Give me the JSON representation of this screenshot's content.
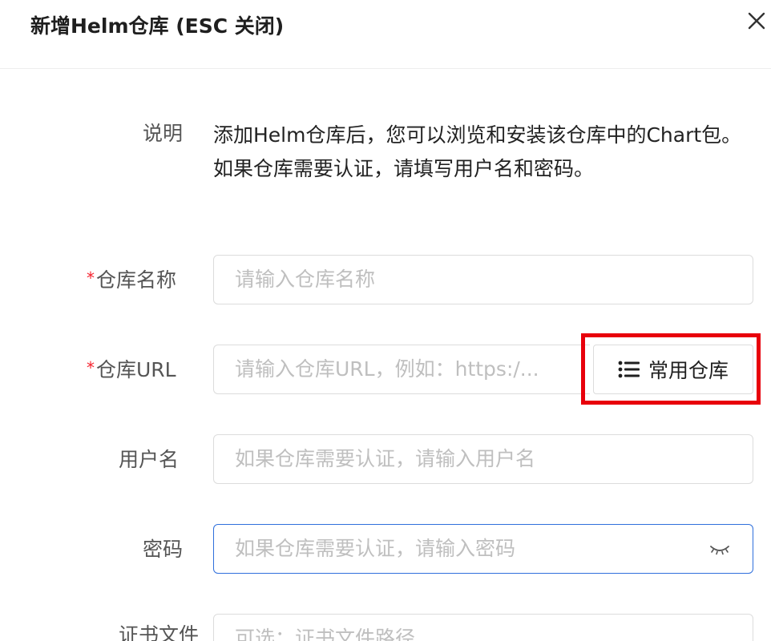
{
  "dialog": {
    "title": "新增Helm仓库 (ESC 关闭)",
    "close_icon": "close-icon"
  },
  "form": {
    "description": {
      "label": "说明",
      "text": "添加Helm仓库后，您可以浏览和安装该仓库中的Chart包。如果仓库需要认证，请填写用户名和密码。"
    },
    "repo_name": {
      "required_mark": "*",
      "label": "仓库名称",
      "placeholder": "请输入仓库名称",
      "value": ""
    },
    "repo_url": {
      "required_mark": "*",
      "label": "仓库URL",
      "placeholder": "请输入仓库URL，例如：https:/...",
      "value": "",
      "common_repo_button": {
        "label": "常用仓库",
        "icon": "list-icon"
      }
    },
    "username": {
      "label": "用户名",
      "placeholder": "如果仓库需要认证，请输入用户名",
      "value": ""
    },
    "password": {
      "label": "密码",
      "placeholder": "如果仓库需要认证，请输入密码",
      "value": "",
      "toggle_icon": "eye-closed-icon"
    },
    "certificate": {
      "label": "证书文件",
      "placeholder": "可选：证书文件路径",
      "value": ""
    }
  },
  "colors": {
    "required": "#f5222d",
    "focus_border": "#2f6fdc",
    "highlight": "#e8000b"
  }
}
